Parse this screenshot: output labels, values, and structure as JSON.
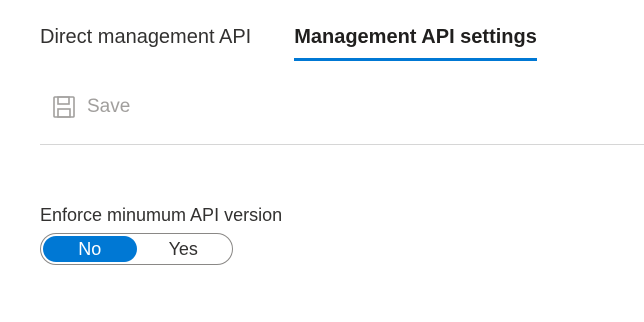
{
  "tabs": [
    {
      "label": "Direct management API",
      "active": false
    },
    {
      "label": "Management API settings",
      "active": true
    }
  ],
  "toolbar": {
    "save_label": "Save",
    "save_icon": "save-icon",
    "save_enabled": false
  },
  "setting": {
    "label": "Enforce minumum API version",
    "options": [
      "No",
      "Yes"
    ],
    "selected": "No"
  },
  "colors": {
    "accent": "#0078d4",
    "disabled_text": "#a19f9d",
    "divider": "#d6d6d6"
  }
}
